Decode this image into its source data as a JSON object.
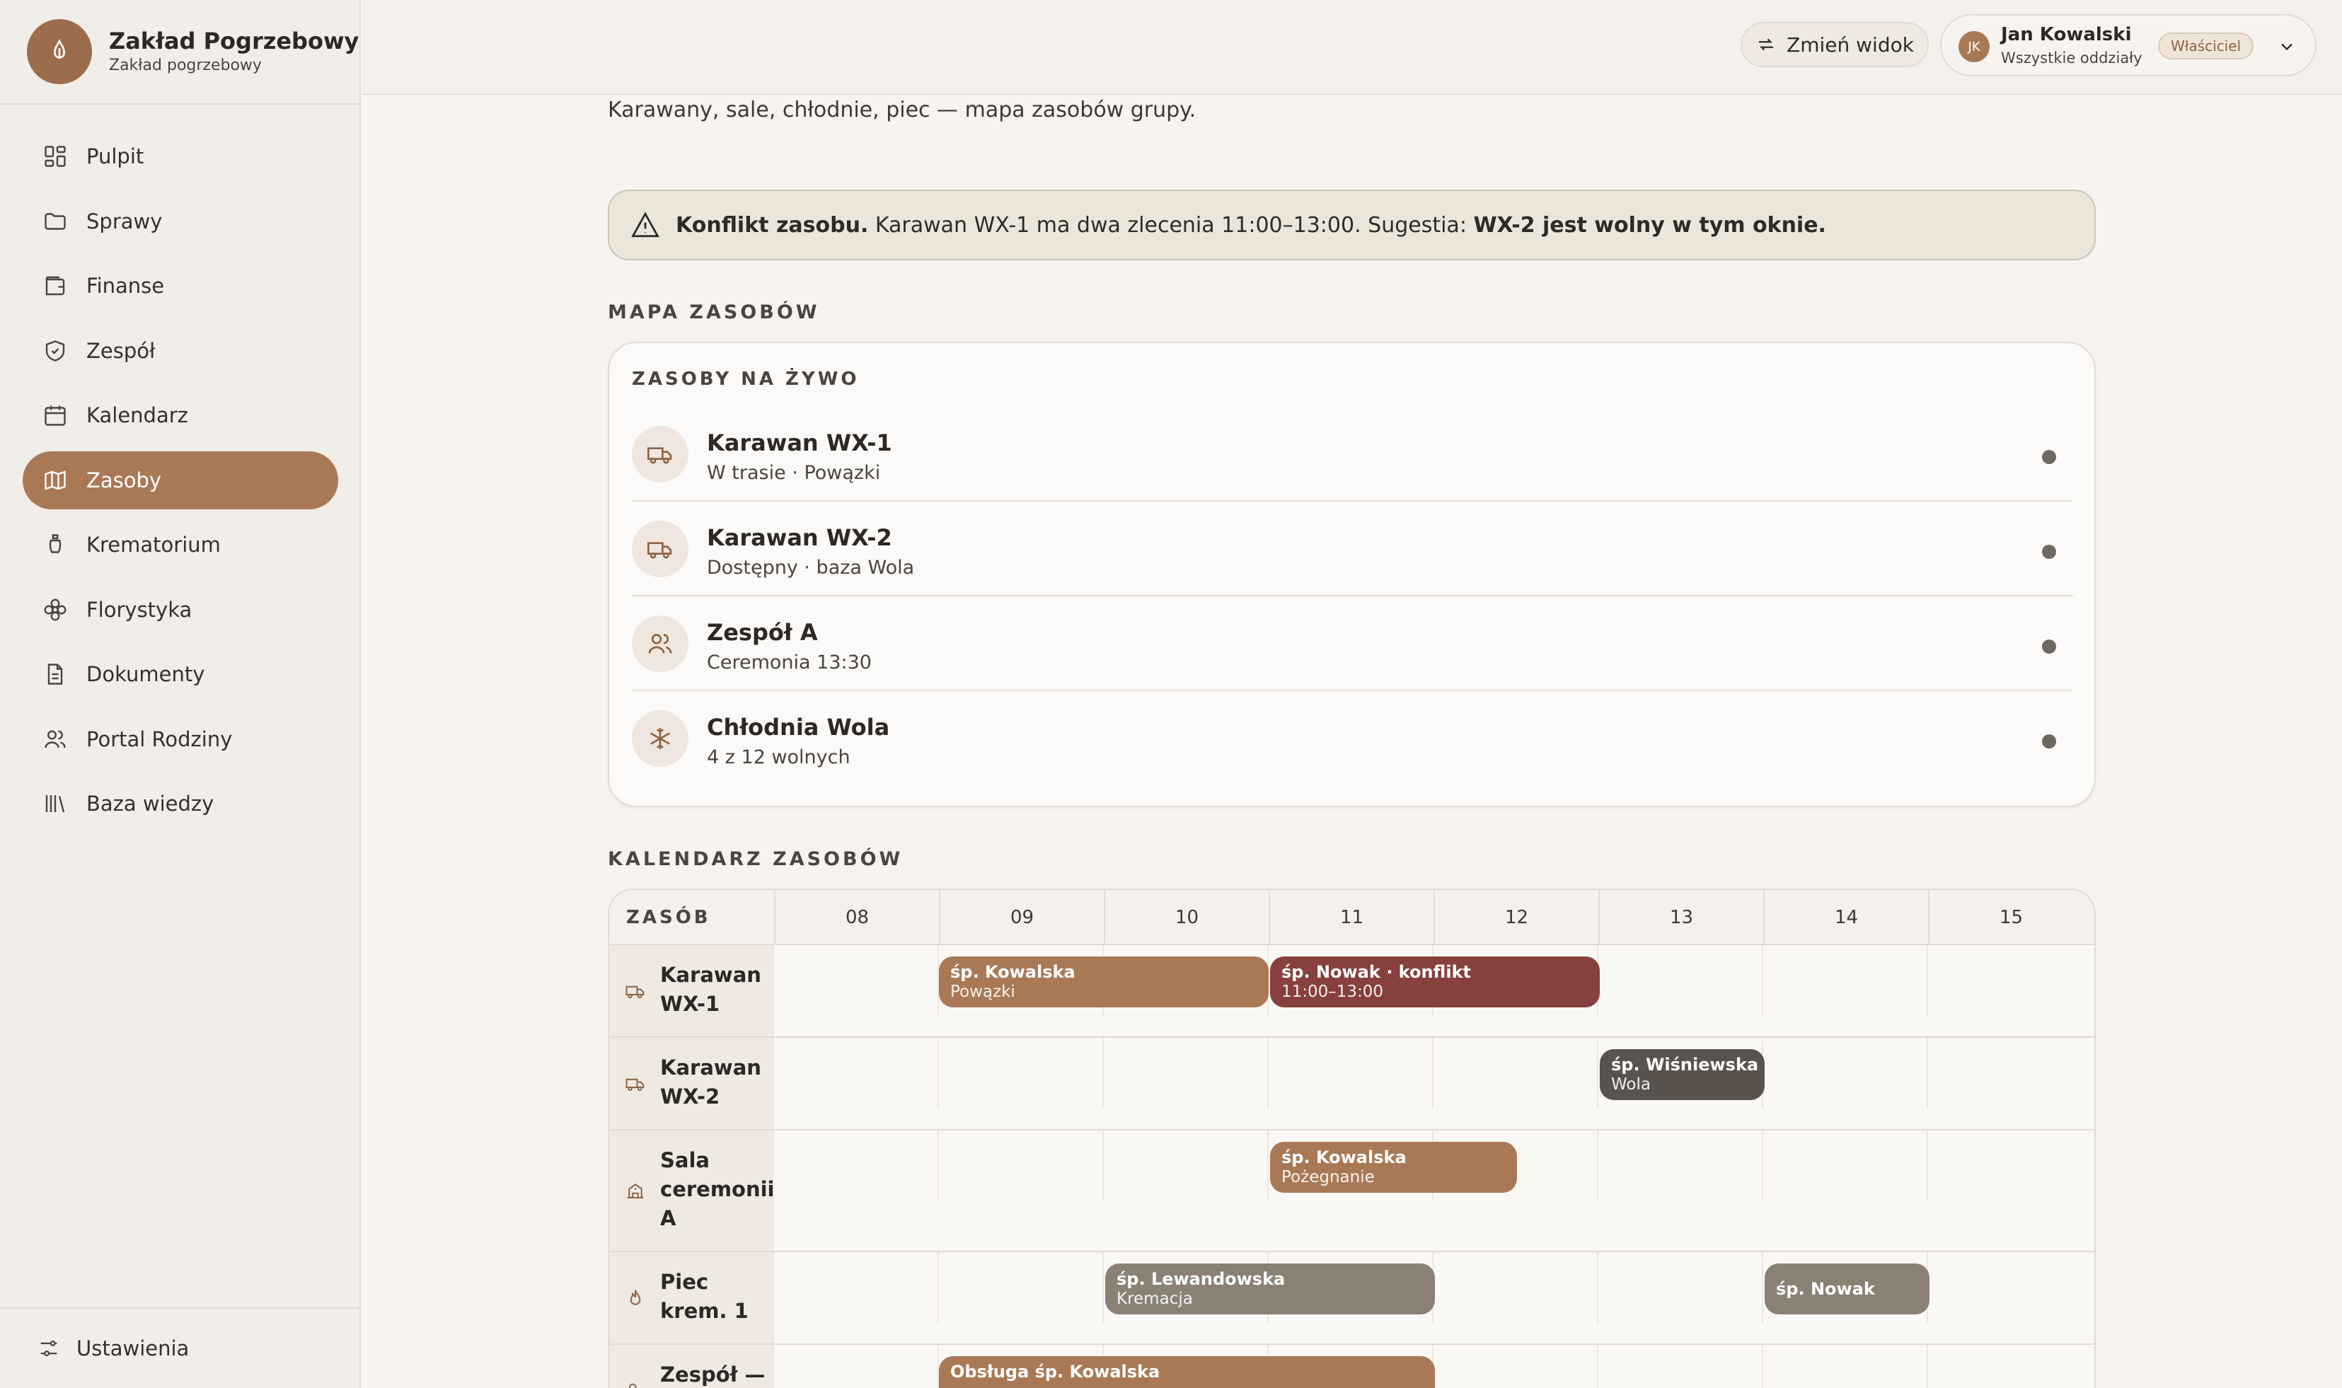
{
  "brand": {
    "title": "Zakład Pogrzebowy",
    "subtitle": "Zakład pogrzebowy"
  },
  "sidebar": {
    "items": [
      {
        "label": "Pulpit",
        "icon": "dashboard-icon"
      },
      {
        "label": "Sprawy",
        "icon": "folder-icon"
      },
      {
        "label": "Finanse",
        "icon": "wallet-icon"
      },
      {
        "label": "Zespół",
        "icon": "shield-icon"
      },
      {
        "label": "Kalendarz",
        "icon": "calendar-icon"
      },
      {
        "label": "Zasoby",
        "icon": "map-icon",
        "active": true
      },
      {
        "label": "Krematorium",
        "icon": "urn-icon"
      },
      {
        "label": "Florystyka",
        "icon": "flower-icon"
      },
      {
        "label": "Dokumenty",
        "icon": "document-icon"
      },
      {
        "label": "Portal Rodziny",
        "icon": "users-icon"
      },
      {
        "label": "Baza wiedzy",
        "icon": "library-icon"
      }
    ],
    "settings_label": "Ustawienia"
  },
  "topbar": {
    "switch_view_label": "Zmień widok",
    "user": {
      "initials": "JK",
      "name": "Jan Kowalski",
      "scope": "Wszystkie oddziały",
      "role": "Właściciel"
    }
  },
  "page": {
    "subtitle": "Karawany, sale, chłodnie, piec — mapa zasobów grupy."
  },
  "alert": {
    "title": "Konflikt zasobu.",
    "body": " Karawan WX-1 ma dwa zlecenia 11:00–13:00. Sugestia: ",
    "suggestion": "WX-2 jest wolny w tym oknie."
  },
  "map_section": {
    "heading": "MAPA ZASOBÓW",
    "card_title": "ZASOBY NA ŻYWO",
    "resources": [
      {
        "name": "Karawan WX-1",
        "meta": "W trasie · Powązki",
        "icon": "truck-icon"
      },
      {
        "name": "Karawan WX-2",
        "meta": "Dostępny · baza Wola",
        "icon": "truck-icon"
      },
      {
        "name": "Zespół A",
        "meta": "Ceremonia 13:30",
        "icon": "users-icon"
      },
      {
        "name": "Chłodnia Wola",
        "meta": "4 z 12 wolnych",
        "icon": "snowflake-icon"
      }
    ]
  },
  "calendar": {
    "heading": "KALENDARZ ZASOBÓW",
    "first_col": "ZASÓB",
    "hours": [
      "08",
      "09",
      "10",
      "11",
      "12",
      "13",
      "14",
      "15"
    ],
    "rows": [
      {
        "name": "Karawan WX-1",
        "icon": "truck-icon"
      },
      {
        "name": "Karawan WX-2",
        "icon": "truck-icon"
      },
      {
        "name": "Sala ceremonii A",
        "icon": "building-icon"
      },
      {
        "name": "Piec krem. 1",
        "icon": "flame-icon"
      },
      {
        "name": "Zespół —",
        "icon": "users-icon"
      }
    ],
    "events": [
      {
        "title": "śp. Kowalska",
        "sub": "Powązki",
        "color": "#a97956"
      },
      {
        "title": "śp. Nowak · konflikt",
        "sub": "11:00–13:00",
        "color": "#86403d"
      },
      {
        "title": "śp. Wiśniewska",
        "sub": "Wola",
        "color": "#5a534d"
      },
      {
        "title": "śp. Kowalska",
        "sub": "Pożegnanie",
        "color": "#a97956"
      },
      {
        "title": "śp. Lewandowska",
        "sub": "Kremacja",
        "color": "#8a8174"
      },
      {
        "title": "śp. Nowak",
        "sub": "",
        "color": "#8a8174"
      },
      {
        "title": "Obsługa śp. Kowalska",
        "sub": "",
        "color": "#a97956"
      }
    ]
  },
  "colors": {
    "accent": "#a97956",
    "conflict": "#86403d",
    "background": "#f7f4f0"
  }
}
